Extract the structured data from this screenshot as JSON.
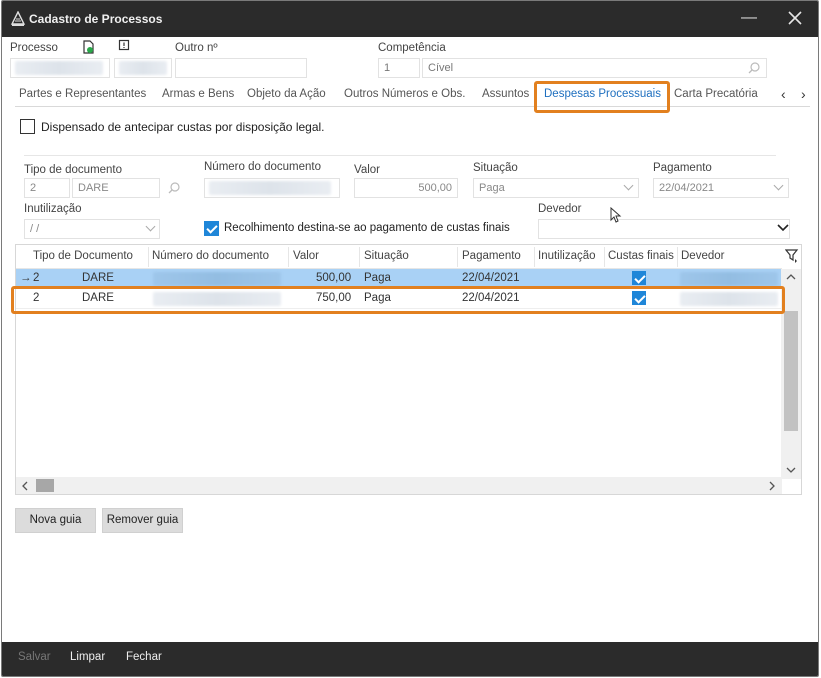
{
  "window": {
    "title": "Cadastro de Processos"
  },
  "header": {
    "processo_label": "Processo",
    "outro_label": "Outro nº",
    "competencia_label": "Competência",
    "competencia_code": "1",
    "competencia_value": "Cível"
  },
  "tabs": [
    {
      "label": "Partes e Representantes"
    },
    {
      "label": "Armas e Bens"
    },
    {
      "label": "Objeto da Ação"
    },
    {
      "label": "Outros Números e Obs."
    },
    {
      "label": "Assuntos"
    },
    {
      "label": "Despesas Processuais"
    },
    {
      "label": "Carta Precatória"
    }
  ],
  "tab_nav": {
    "prev": "‹",
    "next": "›"
  },
  "form": {
    "dispensado_label": "Dispensado de antecipar custas por disposição legal.",
    "tipo_doc_label": "Tipo de documento",
    "tipo_doc_code": "2",
    "tipo_doc_value": "DARE",
    "numero_doc_label": "Número do documento",
    "valor_label": "Valor",
    "valor_value": "500,00",
    "situacao_label": "Situação",
    "situacao_value": "Paga",
    "pagamento_label": "Pagamento",
    "pagamento_value": "22/04/2021",
    "inutilizacao_label": "Inutilização",
    "inutilizacao_value": "/ /",
    "recolhimento_label": "Recolhimento destina-se ao pagamento de custas finais",
    "devedor_label": "Devedor"
  },
  "grid": {
    "columns": [
      "Tipo de Documento",
      "Número do documento",
      "Valor",
      "Situação",
      "Pagamento",
      "Inutilização",
      "Custas finais",
      "Devedor"
    ],
    "rows": [
      {
        "marker": "→",
        "tipo": "2",
        "doc": "DARE",
        "valor": "500,00",
        "situacao": "Paga",
        "pagamento": "22/04/2021",
        "inutilizacao": "",
        "custas_finais": true
      },
      {
        "marker": "",
        "tipo": "2",
        "doc": "DARE",
        "valor": "750,00",
        "situacao": "Paga",
        "pagamento": "22/04/2021",
        "inutilizacao": "",
        "custas_finais": true
      }
    ]
  },
  "buttons": {
    "nova_guia": "Nova guia",
    "remover_guia": "Remover guia"
  },
  "footer": {
    "salvar": "Salvar",
    "limpar": "Limpar",
    "fechar": "Fechar"
  },
  "colors": {
    "accent": "#1f86d8",
    "highlight": "#e2801f",
    "selected_row": "#a9d1f5",
    "titlebar": "#2b2b2b"
  }
}
